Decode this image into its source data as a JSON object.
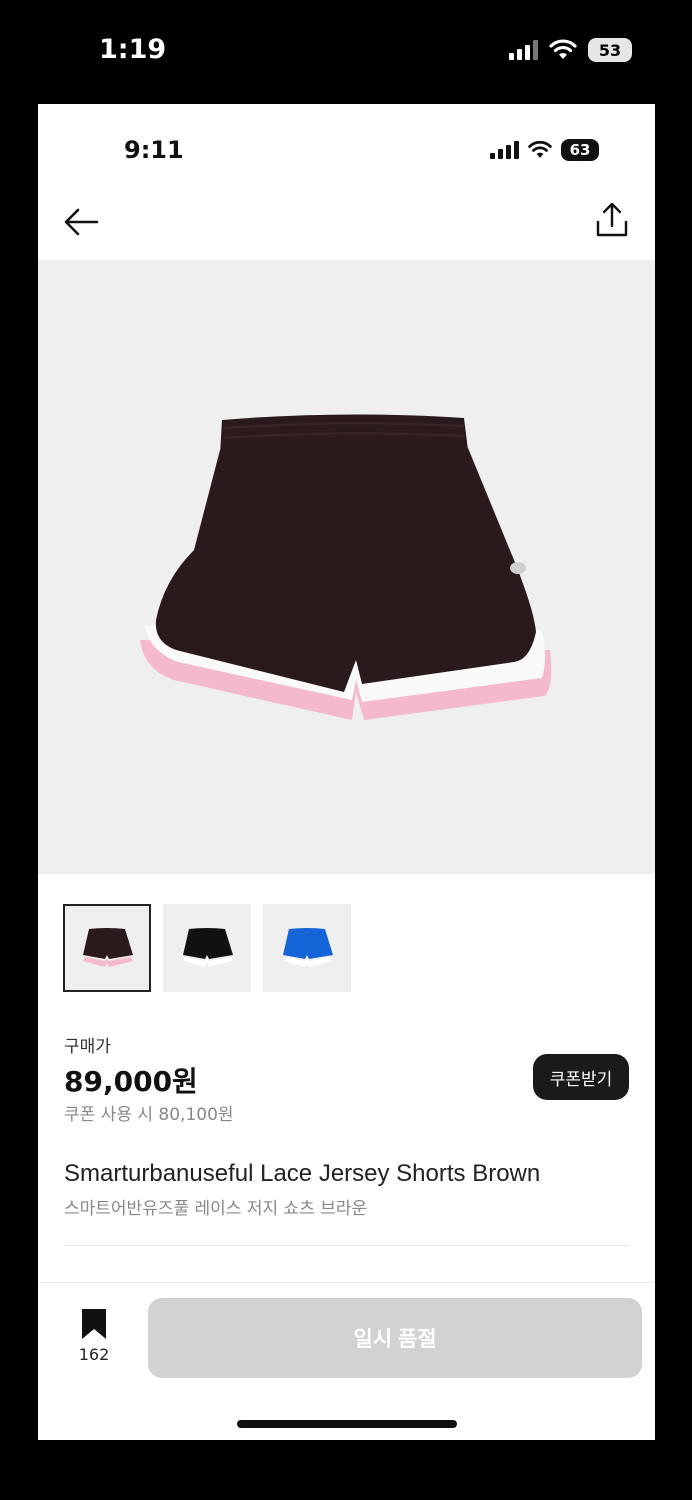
{
  "outer_status": {
    "time": "1:19",
    "battery": "53"
  },
  "inner_status": {
    "time": "9:11",
    "battery": "63"
  },
  "product": {
    "price_label": "구매가",
    "price": "89,000원",
    "coupon_price": "쿠폰 사용 시 80,100원",
    "coupon_button": "쿠폰받기",
    "title_en": "Smarturbanuseful Lace Jersey Shorts Brown",
    "title_ko": "스마트어반유즈풀 레이스 저지 쇼츠 브라운",
    "thumbnails": [
      {
        "name": "brown",
        "color": "#2a1a1c",
        "trim": "#f4b8cf",
        "selected": true
      },
      {
        "name": "black",
        "color": "#111111",
        "trim": "#ffffff",
        "selected": false
      },
      {
        "name": "blue",
        "color": "#1565d8",
        "trim": "#ffffff",
        "selected": false
      }
    ]
  },
  "bottom_bar": {
    "bookmark_count": "162",
    "action_label": "일시 품절"
  },
  "icons": {
    "back": "arrow-left-icon",
    "share": "share-icon",
    "bookmark": "bookmark-icon"
  }
}
